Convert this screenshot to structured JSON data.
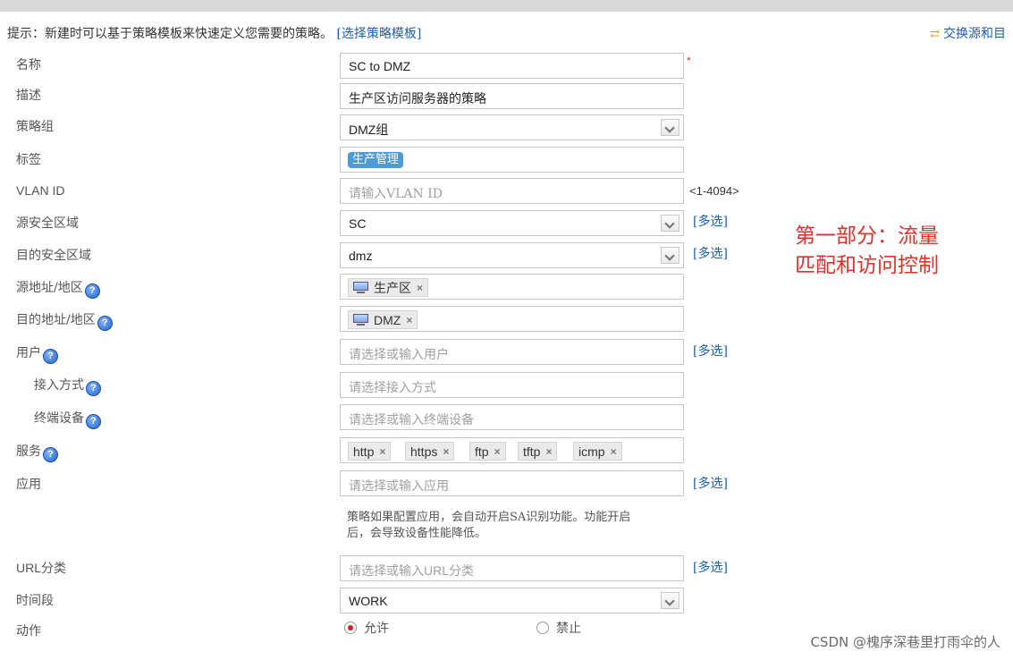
{
  "hint": {
    "text": "提示：新建时可以基于策略模板来快速定义您需要的策略。",
    "link": "[选择策略模板]"
  },
  "swap_link": "交换源和目",
  "fields": {
    "name": {
      "label": "名称",
      "value": "SC to DMZ",
      "required": "*"
    },
    "description": {
      "label": "描述",
      "value": "生产区访问服务器的策略"
    },
    "policy_group": {
      "label": "策略组",
      "value": "DMZ组"
    },
    "tags": {
      "label": "标签",
      "tag": "生产管理"
    },
    "vlan_id": {
      "label": "VLAN ID",
      "placeholder": "请输入VLAN ID",
      "range": "<1-4094>"
    },
    "src_zone": {
      "label": "源安全区域",
      "value": "SC",
      "multi": "[多选]"
    },
    "dst_zone": {
      "label": "目的安全区域",
      "value": "dmz",
      "multi": "[多选]"
    },
    "src_addr": {
      "label": "源地址/地区",
      "chip": "生产区"
    },
    "dst_addr": {
      "label": "目的地址/地区",
      "chip": "DMZ"
    },
    "user": {
      "label": "用户",
      "placeholder": "请选择或输入用户",
      "multi": "[多选]"
    },
    "access_method": {
      "label": "接入方式",
      "placeholder": "请选择接入方式"
    },
    "terminal_device": {
      "label": "终端设备",
      "placeholder": "请选择或输入终端设备"
    },
    "service": {
      "label": "服务",
      "chips": [
        "http",
        "https",
        "ftp",
        "tftp",
        "icmp"
      ]
    },
    "application": {
      "label": "应用",
      "placeholder": "请选择或输入应用",
      "multi": "[多选]",
      "note_line1": "策略如果配置应用，会自动开启SA识别功能。功能开启",
      "note_line2": "后，会导致设备性能降低。"
    },
    "url_category": {
      "label": "URL分类",
      "placeholder": "请选择或输入URL分类",
      "multi": "[多选]"
    },
    "time_range": {
      "label": "时间段",
      "value": "WORK"
    },
    "action": {
      "label": "动作",
      "allow": "允许",
      "deny": "禁止",
      "selected": "allow"
    }
  },
  "help_glyph": "?",
  "remove_glyph": "×",
  "annotation": {
    "line1": "第一部分：流量",
    "line2": "匹配和访问控制"
  },
  "watermark": "CSDN @槐序深巷里打雨伞的人",
  "colors": {
    "link": "#1a5fb4",
    "annotation": "#e0302a",
    "tag": "#4a9bd8",
    "radio_selected": "#d81b1b"
  }
}
